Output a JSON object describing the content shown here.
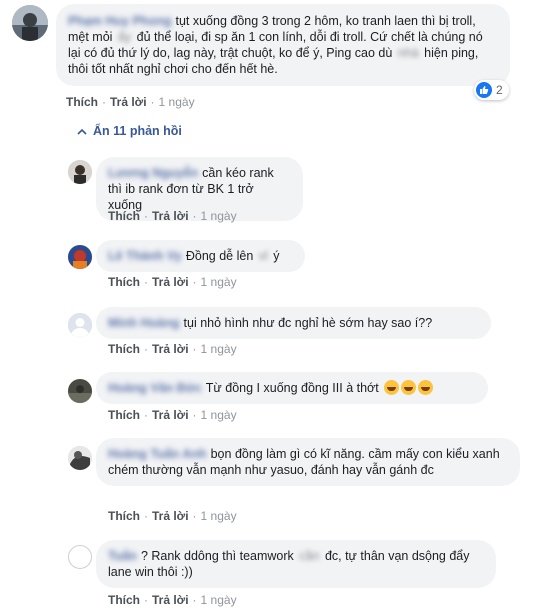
{
  "comments": [
    {
      "id": "main",
      "text_before": "tụt xuống đồng 3 trong 2 hôm, ko tranh laen thì bị troll, mệt mỏi",
      "text_after": "đủ thể loại, đi sp ăn 1 con lính, dỗi đi troll. Cứ chết là chúng nó lại có đủ thứ lý do, lag này, trật chuột, ko để ý, Ping cao dù",
      "text_tail": "hiện ping, thôi tốt nhất nghỉ chơi cho đến hết hè.",
      "reaction_count": "2"
    },
    {
      "id": "r1",
      "text": "cần kéo rank thì ib rank đơn từ BK 1 trở xuống"
    },
    {
      "id": "r2",
      "text_before": "Đồng dễ lên",
      "text_after": "ý"
    },
    {
      "id": "r3",
      "text": "tụi nhỏ hình như đc nghỉ hè sớm hay sao í??"
    },
    {
      "id": "r4",
      "text": "Từ đồng I xuống đồng III à thớt"
    },
    {
      "id": "r5",
      "text": "bọn đồng làm gì có kĩ năng. cầm mấy con kiểu xanh chém thường vẫn mạnh như yasuo, đánh hay vẫn gánh đc"
    },
    {
      "id": "r6",
      "text_before": "? Rank ddông thì teamwork",
      "text_after": "đc, tự thân vạn dsộng đẩy lane win thôi :))"
    }
  ],
  "actions": {
    "like": "Thích",
    "reply": "Trả lời",
    "sep": "·",
    "time": "1 ngày"
  },
  "hide_replies": "Ẩn 11 phản hồi",
  "blurred": {
    "n0": "Phạm Huy Phong",
    "n1": "Lương Nguyễn",
    "n2": "Lê Thành Vy",
    "n3": "Minh Hoàng",
    "n4": "Hoàng Văn Đức",
    "n5": "Hoàng Tuấn Anh",
    "n6": "Tuấn",
    "w1": "ấy",
    "w2": "nhà",
    "w3": "vl",
    "w4": "cần"
  }
}
